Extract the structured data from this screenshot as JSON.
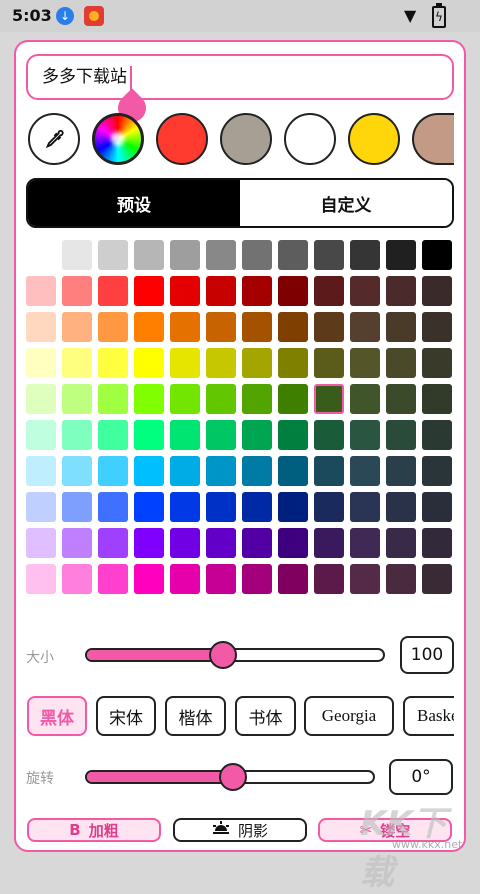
{
  "status_bar": {
    "time": "5:03"
  },
  "text_field": {
    "value": "多多下载站"
  },
  "swatches": [
    {
      "name": "eyedropper",
      "icon": "eyedropper-icon"
    },
    {
      "name": "color-wheel",
      "icon": "color-wheel-icon"
    },
    {
      "name": "red",
      "color": "#ff3b30"
    },
    {
      "name": "taupe",
      "color": "#a89f94"
    },
    {
      "name": "white",
      "color": "#ffffff"
    },
    {
      "name": "yellow",
      "color": "#ffd60a"
    },
    {
      "name": "tan",
      "color": "#c39a86"
    }
  ],
  "tabs": [
    {
      "label": "预设",
      "active": true
    },
    {
      "label": "自定义",
      "active": false
    }
  ],
  "palette": {
    "selected": [
      4,
      8
    ],
    "rows": [
      [
        "#ffffff",
        "#e6e6e6",
        "#cecece",
        "#b6b6b6",
        "#9e9e9e",
        "#888888",
        "#727272",
        "#5d5d5d",
        "#484848",
        "#353535",
        "#202020",
        "#000000"
      ],
      [
        "#ffbfbf",
        "#ff7f7f",
        "#ff4040",
        "#ff0000",
        "#e50000",
        "#c70000",
        "#a50000",
        "#7f0000",
        "#5c1a1a",
        "#552a2a",
        "#4a2a2a",
        "#3a2a2a"
      ],
      [
        "#ffd8bf",
        "#ffb27f",
        "#ff9840",
        "#ff7f00",
        "#e57200",
        "#c76300",
        "#a55200",
        "#7f3f00",
        "#5c3a1a",
        "#554030",
        "#4a3a2a",
        "#3a322a"
      ],
      [
        "#ffffbf",
        "#ffff7f",
        "#ffff40",
        "#ffff00",
        "#e5e500",
        "#c7c700",
        "#a5a500",
        "#7f7f00",
        "#5c5c1a",
        "#55552a",
        "#4a4a2a",
        "#3a3a2a"
      ],
      [
        "#dfffbf",
        "#bfff7f",
        "#9fff40",
        "#7fff00",
        "#72e500",
        "#63c700",
        "#52a500",
        "#3f7f00",
        "#3a5c1a",
        "#40552a",
        "#3a4a2a",
        "#323a2a"
      ],
      [
        "#bfffdf",
        "#7fffbf",
        "#40ff9f",
        "#00ff7f",
        "#00e572",
        "#00c763",
        "#00a552",
        "#007f3f",
        "#1a5c3a",
        "#2a5540",
        "#2a4a3a",
        "#2a3a32"
      ],
      [
        "#bfefff",
        "#7fdfff",
        "#40cfff",
        "#00bfff",
        "#00ace5",
        "#0095c7",
        "#007ba5",
        "#005f7f",
        "#1a4a5c",
        "#2a4855",
        "#2a3f4a",
        "#2a353a"
      ],
      [
        "#bfcfff",
        "#7f9fff",
        "#4070ff",
        "#0040ff",
        "#0039e5",
        "#0031c7",
        "#0029a5",
        "#00207f",
        "#1a2a5c",
        "#2a3555",
        "#2a324a",
        "#2a2d3a"
      ],
      [
        "#dfbfff",
        "#bf7fff",
        "#9f40ff",
        "#7f00ff",
        "#7200e5",
        "#6300c7",
        "#5200a5",
        "#3f007f",
        "#3a1a5c",
        "#402a55",
        "#3a2a4a",
        "#322a3a"
      ],
      [
        "#ffbfef",
        "#ff7fdf",
        "#ff40cf",
        "#ff00bf",
        "#e500ac",
        "#c70095",
        "#a5007b",
        "#7f005f",
        "#5c1a4a",
        "#552a48",
        "#4a2a3f",
        "#3a2a35"
      ]
    ]
  },
  "size": {
    "label": "大小",
    "value": "100",
    "fraction": 0.46
  },
  "fonts": [
    "黑体",
    "宋体",
    "楷体",
    "书体",
    "Georgia",
    "Baskerville"
  ],
  "active_font_index": 0,
  "rotation": {
    "label": "旋转",
    "value": "0°",
    "fraction": 0.51
  },
  "actions": {
    "bold": {
      "icon": "B",
      "label": "加粗"
    },
    "shadow": {
      "icon": "shadow-icon",
      "label": "阴影"
    },
    "hollow": {
      "icon": "scissors-icon",
      "label": "镂空"
    }
  },
  "accent_color": "#f25aa8",
  "watermark": {
    "text": "KK下载",
    "url": "www.kkx.net"
  }
}
